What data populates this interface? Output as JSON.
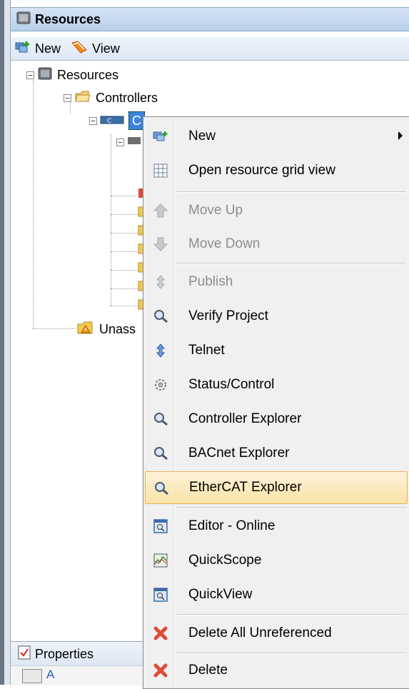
{
  "panel": {
    "title": "Resources",
    "toolbar": {
      "new_label": "New",
      "view_label": "View"
    }
  },
  "tree": {
    "root": "Resources",
    "controllers": "Controllers",
    "controller_item": "C",
    "unassigned": "Unass"
  },
  "properties": {
    "label": "Properties",
    "sort_alpha": "A"
  },
  "context_menu": {
    "items": [
      {
        "label": "New",
        "icon": "new-resource-icon",
        "disabled": false,
        "submenu": true
      },
      {
        "label": "Open resource grid view",
        "icon": "grid-icon",
        "disabled": false
      },
      {
        "label": "Move Up",
        "icon": "arrow-up-icon",
        "disabled": true
      },
      {
        "label": "Move Down",
        "icon": "arrow-down-icon",
        "disabled": true
      },
      {
        "label": "Publish",
        "icon": "publish-icon",
        "disabled": true
      },
      {
        "label": "Verify Project",
        "icon": "magnifier-icon",
        "disabled": false
      },
      {
        "label": "Telnet",
        "icon": "telnet-icon",
        "disabled": false
      },
      {
        "label": "Status/Control",
        "icon": "gear-icon",
        "disabled": false
      },
      {
        "label": "Controller Explorer",
        "icon": "magnifier-icon",
        "disabled": false
      },
      {
        "label": "BACnet Explorer",
        "icon": "magnifier-icon",
        "disabled": false
      },
      {
        "label": "EtherCAT Explorer",
        "icon": "magnifier-icon",
        "disabled": false,
        "highlighted": true
      },
      {
        "label": "Editor - Online",
        "icon": "editor-online-icon",
        "disabled": false
      },
      {
        "label": "QuickScope",
        "icon": "quickscope-icon",
        "disabled": false
      },
      {
        "label": "QuickView",
        "icon": "quickview-icon",
        "disabled": false
      },
      {
        "label": "Delete All Unreferenced",
        "icon": "delete-icon",
        "disabled": false
      },
      {
        "label": "Delete",
        "icon": "delete-icon",
        "disabled": false
      }
    ]
  },
  "colors": {
    "highlight": "#fbe3a8",
    "selection": "#3a86d8",
    "disabled_text": "#8d8d8d"
  }
}
